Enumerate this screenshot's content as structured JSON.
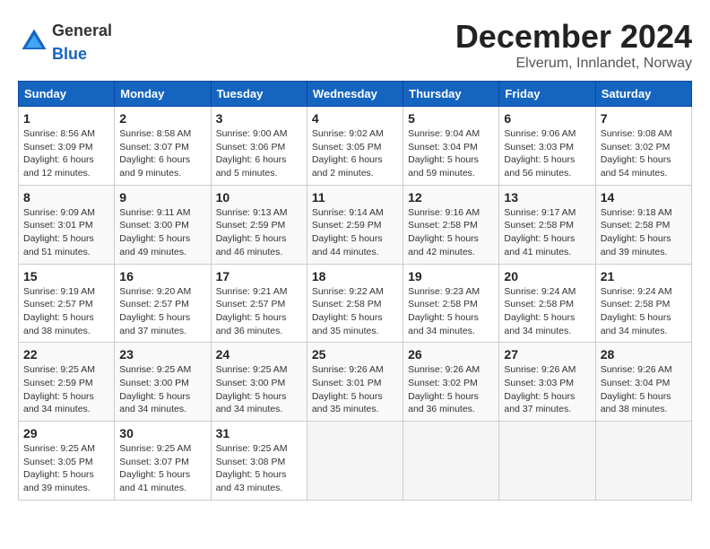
{
  "header": {
    "logo_general": "General",
    "logo_blue": "Blue",
    "month_title": "December 2024",
    "subtitle": "Elverum, Innlandet, Norway"
  },
  "days_of_week": [
    "Sunday",
    "Monday",
    "Tuesday",
    "Wednesday",
    "Thursday",
    "Friday",
    "Saturday"
  ],
  "weeks": [
    [
      {
        "day": "1",
        "sunrise": "Sunrise: 8:56 AM",
        "sunset": "Sunset: 3:09 PM",
        "daylight": "Daylight: 6 hours and 12 minutes."
      },
      {
        "day": "2",
        "sunrise": "Sunrise: 8:58 AM",
        "sunset": "Sunset: 3:07 PM",
        "daylight": "Daylight: 6 hours and 9 minutes."
      },
      {
        "day": "3",
        "sunrise": "Sunrise: 9:00 AM",
        "sunset": "Sunset: 3:06 PM",
        "daylight": "Daylight: 6 hours and 5 minutes."
      },
      {
        "day": "4",
        "sunrise": "Sunrise: 9:02 AM",
        "sunset": "Sunset: 3:05 PM",
        "daylight": "Daylight: 6 hours and 2 minutes."
      },
      {
        "day": "5",
        "sunrise": "Sunrise: 9:04 AM",
        "sunset": "Sunset: 3:04 PM",
        "daylight": "Daylight: 5 hours and 59 minutes."
      },
      {
        "day": "6",
        "sunrise": "Sunrise: 9:06 AM",
        "sunset": "Sunset: 3:03 PM",
        "daylight": "Daylight: 5 hours and 56 minutes."
      },
      {
        "day": "7",
        "sunrise": "Sunrise: 9:08 AM",
        "sunset": "Sunset: 3:02 PM",
        "daylight": "Daylight: 5 hours and 54 minutes."
      }
    ],
    [
      {
        "day": "8",
        "sunrise": "Sunrise: 9:09 AM",
        "sunset": "Sunset: 3:01 PM",
        "daylight": "Daylight: 5 hours and 51 minutes."
      },
      {
        "day": "9",
        "sunrise": "Sunrise: 9:11 AM",
        "sunset": "Sunset: 3:00 PM",
        "daylight": "Daylight: 5 hours and 49 minutes."
      },
      {
        "day": "10",
        "sunrise": "Sunrise: 9:13 AM",
        "sunset": "Sunset: 2:59 PM",
        "daylight": "Daylight: 5 hours and 46 minutes."
      },
      {
        "day": "11",
        "sunrise": "Sunrise: 9:14 AM",
        "sunset": "Sunset: 2:59 PM",
        "daylight": "Daylight: 5 hours and 44 minutes."
      },
      {
        "day": "12",
        "sunrise": "Sunrise: 9:16 AM",
        "sunset": "Sunset: 2:58 PM",
        "daylight": "Daylight: 5 hours and 42 minutes."
      },
      {
        "day": "13",
        "sunrise": "Sunrise: 9:17 AM",
        "sunset": "Sunset: 2:58 PM",
        "daylight": "Daylight: 5 hours and 41 minutes."
      },
      {
        "day": "14",
        "sunrise": "Sunrise: 9:18 AM",
        "sunset": "Sunset: 2:58 PM",
        "daylight": "Daylight: 5 hours and 39 minutes."
      }
    ],
    [
      {
        "day": "15",
        "sunrise": "Sunrise: 9:19 AM",
        "sunset": "Sunset: 2:57 PM",
        "daylight": "Daylight: 5 hours and 38 minutes."
      },
      {
        "day": "16",
        "sunrise": "Sunrise: 9:20 AM",
        "sunset": "Sunset: 2:57 PM",
        "daylight": "Daylight: 5 hours and 37 minutes."
      },
      {
        "day": "17",
        "sunrise": "Sunrise: 9:21 AM",
        "sunset": "Sunset: 2:57 PM",
        "daylight": "Daylight: 5 hours and 36 minutes."
      },
      {
        "day": "18",
        "sunrise": "Sunrise: 9:22 AM",
        "sunset": "Sunset: 2:58 PM",
        "daylight": "Daylight: 5 hours and 35 minutes."
      },
      {
        "day": "19",
        "sunrise": "Sunrise: 9:23 AM",
        "sunset": "Sunset: 2:58 PM",
        "daylight": "Daylight: 5 hours and 34 minutes."
      },
      {
        "day": "20",
        "sunrise": "Sunrise: 9:24 AM",
        "sunset": "Sunset: 2:58 PM",
        "daylight": "Daylight: 5 hours and 34 minutes."
      },
      {
        "day": "21",
        "sunrise": "Sunrise: 9:24 AM",
        "sunset": "Sunset: 2:58 PM",
        "daylight": "Daylight: 5 hours and 34 minutes."
      }
    ],
    [
      {
        "day": "22",
        "sunrise": "Sunrise: 9:25 AM",
        "sunset": "Sunset: 2:59 PM",
        "daylight": "Daylight: 5 hours and 34 minutes."
      },
      {
        "day": "23",
        "sunrise": "Sunrise: 9:25 AM",
        "sunset": "Sunset: 3:00 PM",
        "daylight": "Daylight: 5 hours and 34 minutes."
      },
      {
        "day": "24",
        "sunrise": "Sunrise: 9:25 AM",
        "sunset": "Sunset: 3:00 PM",
        "daylight": "Daylight: 5 hours and 34 minutes."
      },
      {
        "day": "25",
        "sunrise": "Sunrise: 9:26 AM",
        "sunset": "Sunset: 3:01 PM",
        "daylight": "Daylight: 5 hours and 35 minutes."
      },
      {
        "day": "26",
        "sunrise": "Sunrise: 9:26 AM",
        "sunset": "Sunset: 3:02 PM",
        "daylight": "Daylight: 5 hours and 36 minutes."
      },
      {
        "day": "27",
        "sunrise": "Sunrise: 9:26 AM",
        "sunset": "Sunset: 3:03 PM",
        "daylight": "Daylight: 5 hours and 37 minutes."
      },
      {
        "day": "28",
        "sunrise": "Sunrise: 9:26 AM",
        "sunset": "Sunset: 3:04 PM",
        "daylight": "Daylight: 5 hours and 38 minutes."
      }
    ],
    [
      {
        "day": "29",
        "sunrise": "Sunrise: 9:25 AM",
        "sunset": "Sunset: 3:05 PM",
        "daylight": "Daylight: 5 hours and 39 minutes."
      },
      {
        "day": "30",
        "sunrise": "Sunrise: 9:25 AM",
        "sunset": "Sunset: 3:07 PM",
        "daylight": "Daylight: 5 hours and 41 minutes."
      },
      {
        "day": "31",
        "sunrise": "Sunrise: 9:25 AM",
        "sunset": "Sunset: 3:08 PM",
        "daylight": "Daylight: 5 hours and 43 minutes."
      },
      null,
      null,
      null,
      null
    ]
  ]
}
